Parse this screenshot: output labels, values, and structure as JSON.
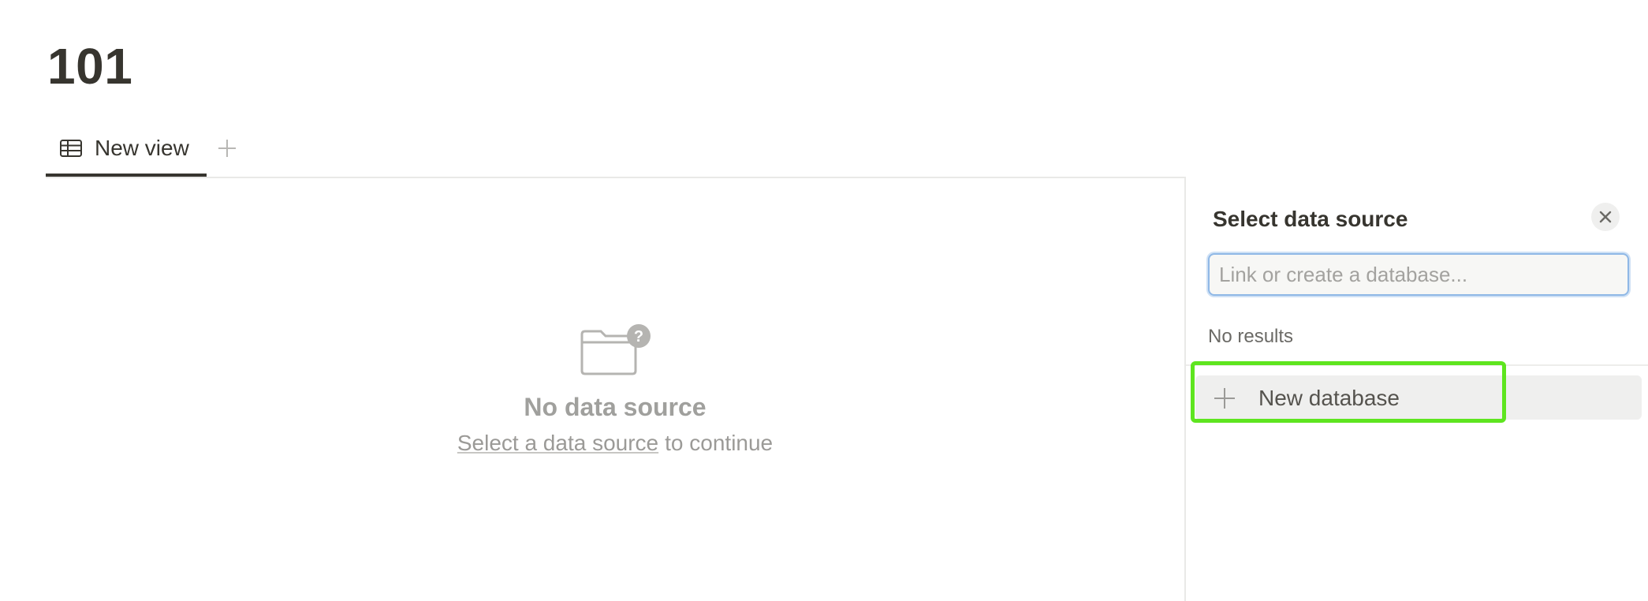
{
  "page": {
    "title": "101"
  },
  "views": {
    "tabs": [
      {
        "label": "New view",
        "icon": "table-icon",
        "active": true
      }
    ],
    "add_icon": "plus-icon"
  },
  "empty_state": {
    "icon": "folder-question-icon",
    "title": "No data source",
    "link_text": "Select a data source",
    "suffix": "to continue"
  },
  "panel": {
    "title": "Select data source",
    "close_icon": "close-icon",
    "search": {
      "placeholder": "Link or create a database...",
      "value": ""
    },
    "no_results": "No results",
    "new_database": {
      "label": "New database",
      "icon": "plus-icon"
    }
  },
  "colors": {
    "text": "#37352f",
    "muted": "#9b9a97",
    "focus": "#8fb8e6",
    "highlight": "#5ee51f"
  }
}
